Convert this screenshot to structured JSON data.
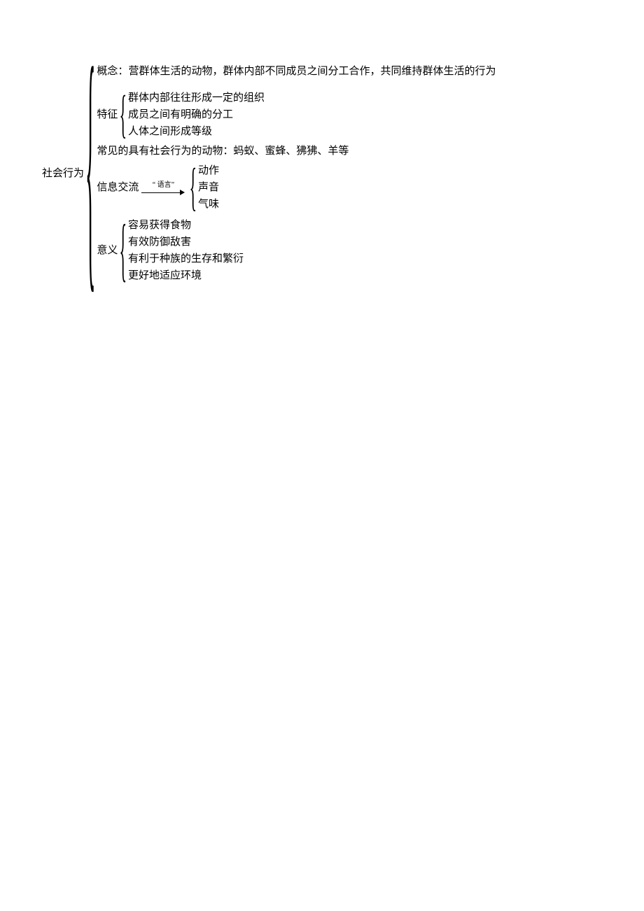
{
  "root": {
    "label": "社会行为"
  },
  "concept": {
    "label": "概念：",
    "text": "营群体生活的动物，群体内部不同成员之间分工合作，共同维持群体生活的行为"
  },
  "features": {
    "label": "特征",
    "items": [
      "群体内部往往形成一定的组织",
      "成员之间有明确的分工",
      "人体之间形成等级"
    ]
  },
  "common": {
    "text": "常见的具有社会行为的动物：蚂蚁、蜜蜂、狒狒、羊等"
  },
  "communication": {
    "label": "信息交流",
    "arrow_label": "“ 语言”",
    "items": [
      "动作",
      "声音",
      "气味"
    ]
  },
  "significance": {
    "label": "意义",
    "items": [
      "容易获得食物",
      "有效防御敌害",
      "有利于种族的生存和繁衍",
      "更好地适应环境"
    ]
  }
}
